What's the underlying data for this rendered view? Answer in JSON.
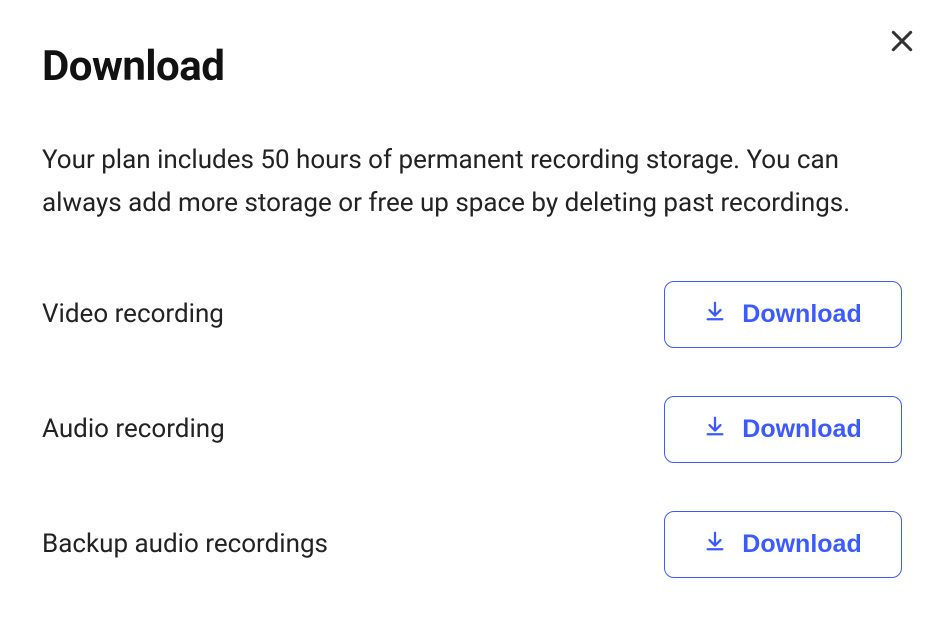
{
  "dialog": {
    "title": "Download",
    "description": "Your plan includes 50 hours of permanent recording storage. You can always add more storage or free up space by deleting past recordings."
  },
  "items": [
    {
      "label": "Video recording",
      "button_label": "Download"
    },
    {
      "label": "Audio recording",
      "button_label": "Download"
    },
    {
      "label": "Backup audio recordings",
      "button_label": "Download"
    }
  ],
  "colors": {
    "accent": "#3B5BFF"
  }
}
